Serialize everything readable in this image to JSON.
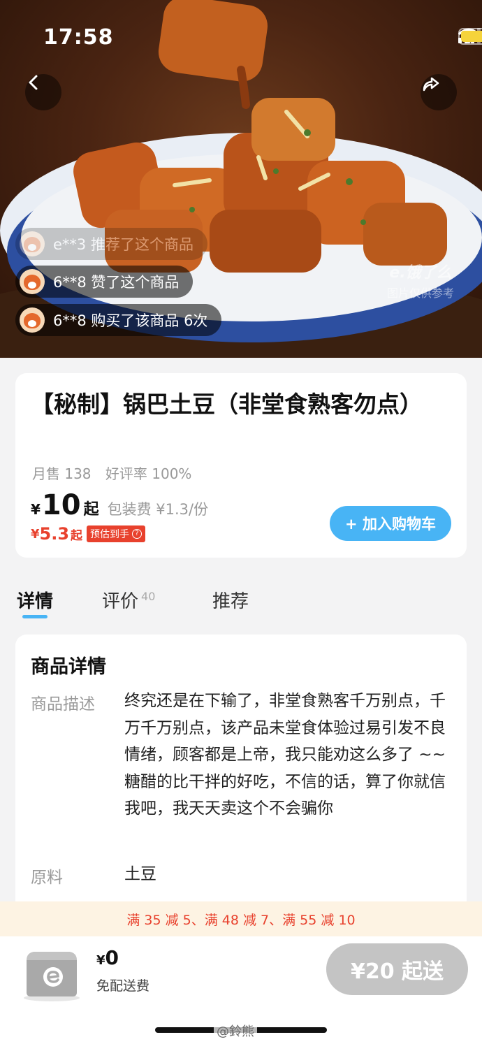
{
  "status_bar": {
    "time": "17:58"
  },
  "hero": {
    "watermark_brand": "e.饿了么",
    "watermark_note": "图片仅供参考",
    "activity_feed": [
      {
        "text": "e**3 推荐了这个商品"
      },
      {
        "text": "6**8 赞了这个商品"
      },
      {
        "text": "6**8 购买了该商品 6次"
      }
    ]
  },
  "product": {
    "title": "【秘制】锅巴土豆（非堂食熟客勿点）",
    "monthly_sales": "月售 138",
    "rating": "好评率 100%",
    "price_symbol": "¥",
    "price": "10",
    "price_suffix": "起",
    "packaging_fee": "包装费 ¥1.3/份",
    "est_symbol": "¥",
    "est_price": "5.3",
    "est_suffix": "起",
    "est_badge": "预估到手",
    "est_help_icon": "?",
    "add_to_cart": "+ 加入购物车"
  },
  "tabs": [
    {
      "label": "详情",
      "active": true
    },
    {
      "label": "评价",
      "count": "40"
    },
    {
      "label": "推荐"
    }
  ],
  "details": {
    "heading": "商品详情",
    "rows": [
      {
        "label": "商品描述",
        "value": "终究还是在下输了，非堂食熟客千万别点，千万千万别点，该产品未堂食体验过易引发不良情绪，顾客都是上帝，我只能劝这么多了 ~~ 糖醋的比干拌的好吃，不信的话，算了你就信我吧，我天天卖这个不会骗你"
      },
      {
        "label": "原料",
        "value": "土豆"
      }
    ]
  },
  "promo": "满 35 减 5、满 48 减 7、满 55 减 10",
  "bottom_bar": {
    "fee_symbol": "¥",
    "fee_value": "0",
    "free_delivery": "免配送费",
    "min_order_button": "¥20 起送"
  },
  "weibo_watermark": "@鈴熊",
  "colors": {
    "accent_blue": "#48b4f5",
    "price_red": "#e8412d",
    "promo_bg": "#fdf3e3",
    "disabled_gray": "#c4c4c4"
  }
}
